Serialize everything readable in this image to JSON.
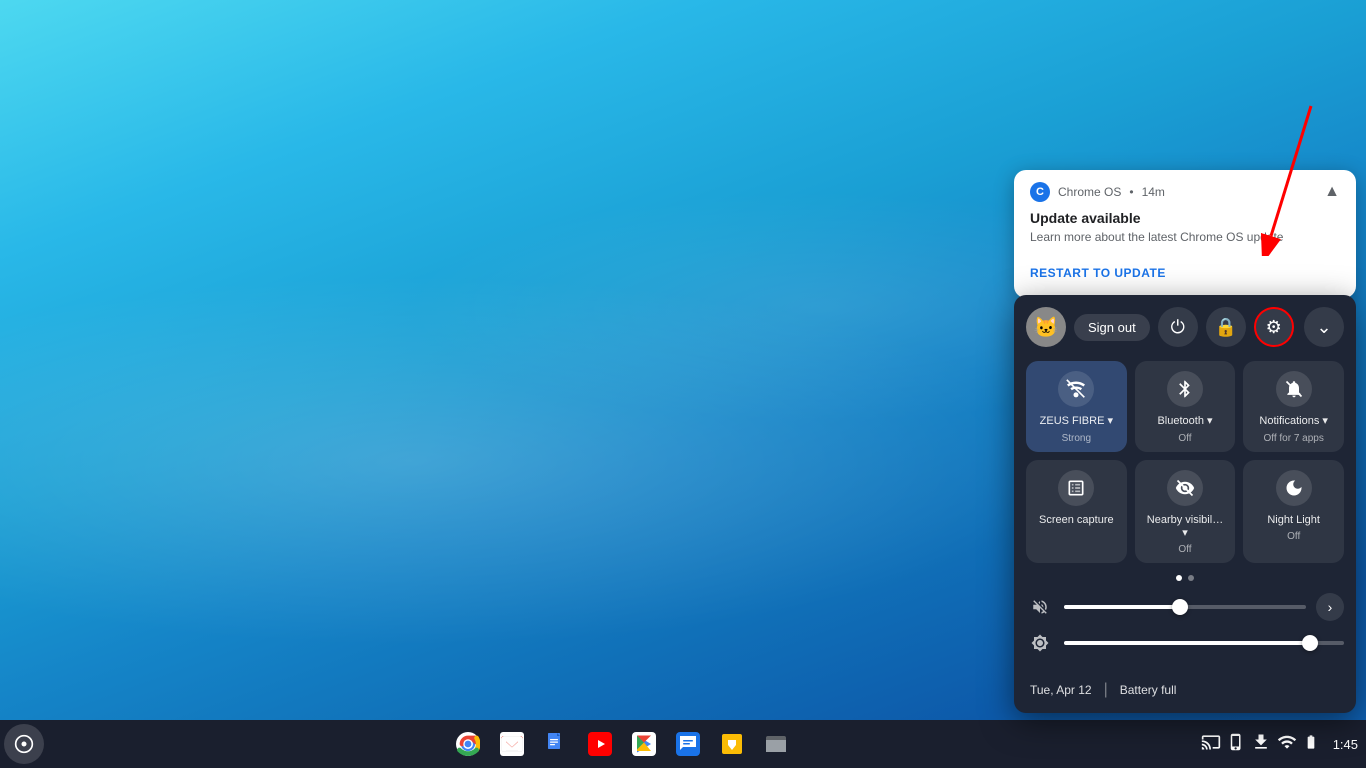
{
  "desktop": {
    "background": "blue-wave"
  },
  "notification": {
    "app_name": "Chrome OS",
    "time": "14m",
    "title": "Update available",
    "body": "Learn more about the latest Chrome OS update",
    "action_label": "RESTART TO UPDATE",
    "chevron": "▲"
  },
  "quick_panel": {
    "user_avatar_emoji": "🐱",
    "sign_out_label": "Sign out",
    "power_icon": "⏻",
    "lock_icon": "🔒",
    "settings_icon": "⚙",
    "expand_icon": "⌄",
    "toggles": [
      {
        "id": "wifi",
        "icon": "wifi-locked",
        "label": "ZEUS FIBRE ▾",
        "sublabel": "Strong",
        "active": true
      },
      {
        "id": "bluetooth",
        "icon": "bluetooth",
        "label": "Bluetooth ▾",
        "sublabel": "Off",
        "active": false
      },
      {
        "id": "notifications",
        "icon": "notifications-off",
        "label": "Notifications ▾",
        "sublabel": "Off for 7 apps",
        "active": false
      },
      {
        "id": "screen-capture",
        "icon": "screen-capture",
        "label": "Screen capture",
        "sublabel": "",
        "active": false
      },
      {
        "id": "nearby",
        "icon": "nearby-share",
        "label": "Nearby visibil… ▾",
        "sublabel": "Off",
        "active": false
      },
      {
        "id": "night-light",
        "icon": "night-light",
        "label": "Night Light",
        "sublabel": "Off",
        "active": false
      }
    ],
    "pagination": {
      "dots": 2,
      "active": 0
    },
    "sliders": [
      {
        "id": "volume",
        "icon": "mute",
        "fill_percent": 48,
        "has_expand": true
      },
      {
        "id": "brightness",
        "icon": "brightness",
        "fill_percent": 88,
        "has_expand": false
      }
    ],
    "footer": {
      "date": "Tue, Apr 12",
      "separator": "|",
      "battery": "Battery full"
    }
  },
  "taskbar": {
    "launcher_icon": "⊙",
    "apps": [
      {
        "id": "chrome",
        "icon": "chrome",
        "emoji": "🌐"
      },
      {
        "id": "gmail",
        "icon": "gmail",
        "emoji": "✉"
      },
      {
        "id": "docs",
        "icon": "docs",
        "emoji": "📄"
      },
      {
        "id": "youtube",
        "icon": "youtube",
        "emoji": "▶"
      },
      {
        "id": "play",
        "icon": "play",
        "emoji": "▷"
      },
      {
        "id": "chat",
        "icon": "chat",
        "emoji": "💬"
      },
      {
        "id": "keep",
        "icon": "keep",
        "emoji": "💡"
      },
      {
        "id": "files",
        "icon": "files",
        "emoji": "📁"
      }
    ],
    "sys": {
      "screen_icon": "⬛",
      "phone_icon": "📱",
      "download_icon": "⬇",
      "wifi_icon": "wifi",
      "battery_icon": "🔋",
      "time": "1:45"
    }
  }
}
